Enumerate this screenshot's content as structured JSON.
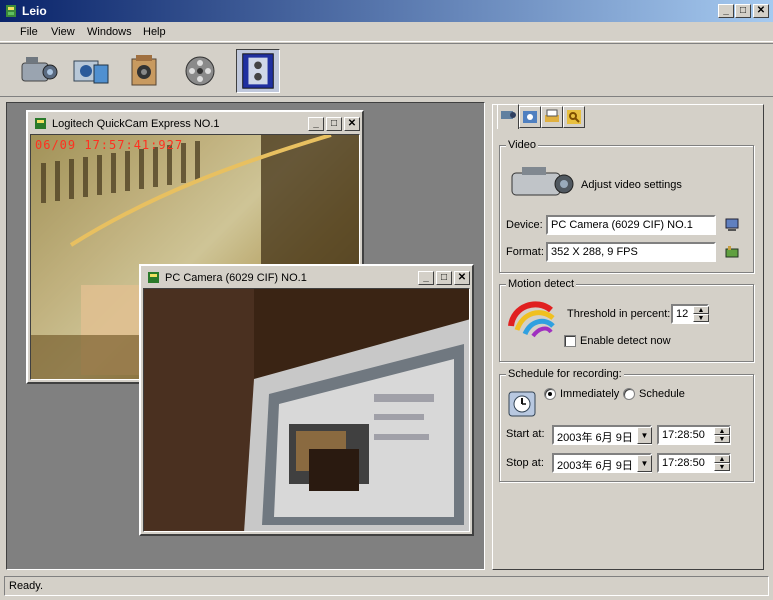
{
  "app": {
    "title": "Leio"
  },
  "caption_buttons": {
    "minimize": "_",
    "maximize": "□",
    "close": "✕"
  },
  "menu": [
    {
      "label": "File"
    },
    {
      "label": "View"
    },
    {
      "label": "Windows"
    },
    {
      "label": "Help"
    }
  ],
  "toolbar": {
    "buttons": [
      {
        "icon": "camcorder-icon"
      },
      {
        "icon": "webcam-icon"
      },
      {
        "icon": "vintage-camera-icon"
      },
      {
        "icon": "film-reel-icon"
      },
      {
        "icon": "surveillance-icon",
        "active": true
      }
    ]
  },
  "windows": {
    "cam1": {
      "title": "Logitech QuickCam Express   NO.1",
      "timestamp": "06/09 17:57:41:927"
    },
    "cam2": {
      "title": "PC Camera (6029 CIF)   NO.1"
    }
  },
  "panel": {
    "tabs": [
      {
        "icon": "camera-tab-icon",
        "selected": true
      },
      {
        "icon": "settings-tab-icon"
      },
      {
        "icon": "printer-tab-icon"
      },
      {
        "icon": "key-tab-icon"
      }
    ],
    "video": {
      "group_label": "Video",
      "adjust_label": "Adjust video settings",
      "device_label": "Device:",
      "device_value": "PC Camera (6029 CIF)   NO.1",
      "format_label": "Format:",
      "format_value": "352 X 288, 9 FPS"
    },
    "motion": {
      "group_label": "Motion detect",
      "threshold_label": "Threshold in percent:",
      "threshold_value": "12",
      "enable_label": "Enable detect now",
      "enable_checked": false
    },
    "schedule": {
      "group_label": "Schedule for recording:",
      "immediately_label": "Immediately",
      "schedule_label": "Schedule",
      "selected": "Immediately",
      "start_label": "Start at:",
      "start_date": "2003年  6月  9日",
      "start_time": "17:28:50",
      "stop_label": "Stop  at:",
      "stop_date": "2003年  6月  9日",
      "stop_time": "17:28:50"
    }
  },
  "status": {
    "text": "Ready."
  },
  "colors": {
    "titlebar": "#0a246a",
    "timestamp": "#ff3020"
  }
}
